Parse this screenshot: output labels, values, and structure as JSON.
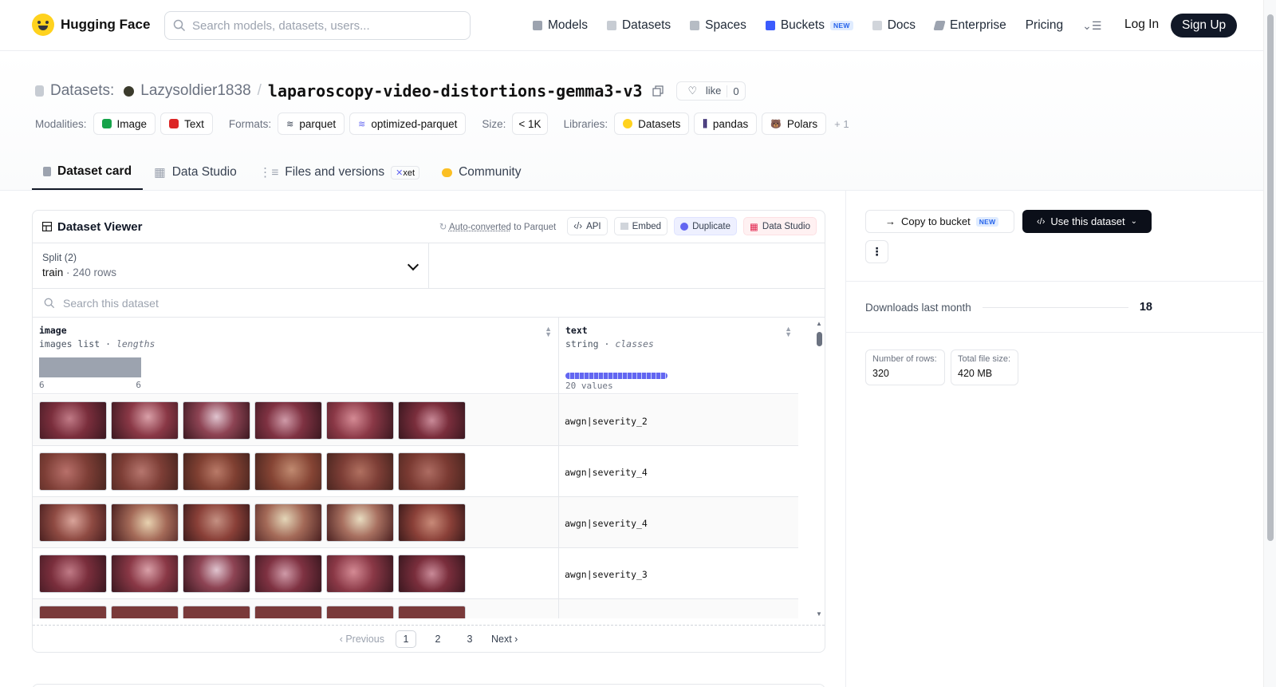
{
  "brand": {
    "name": "Hugging Face"
  },
  "search": {
    "placeholder": "Search models, datasets, users..."
  },
  "nav": {
    "items": [
      {
        "label": "Models",
        "icon": "models-icon"
      },
      {
        "label": "Datasets",
        "icon": "datasets-icon"
      },
      {
        "label": "Spaces",
        "icon": "spaces-icon"
      },
      {
        "label": "Buckets",
        "icon": "buckets-icon",
        "badge": "NEW"
      },
      {
        "label": "Docs",
        "icon": "docs-icon"
      },
      {
        "label": "Enterprise",
        "icon": "enterprise-icon"
      },
      {
        "label": "Pricing"
      }
    ],
    "login": "Log In",
    "signup": "Sign Up"
  },
  "repo": {
    "section": "Datasets:",
    "owner": "Lazysoldier1838",
    "separator": "/",
    "name": "laparoscopy-video-distortions-gemma3-v3",
    "like_label": "like",
    "like_count": "0"
  },
  "meta": {
    "modalities_label": "Modalities:",
    "modalities": [
      "Image",
      "Text"
    ],
    "formats_label": "Formats:",
    "formats": [
      "parquet",
      "optimized-parquet"
    ],
    "size_label": "Size:",
    "size": "< 1K",
    "libraries_label": "Libraries:",
    "libraries": [
      "Datasets",
      "pandas",
      "Polars"
    ],
    "more_libraries": "+ 1"
  },
  "tabs": [
    {
      "label": "Dataset card",
      "active": true
    },
    {
      "label": "Data Studio"
    },
    {
      "label": "Files and versions",
      "badge": "xet"
    },
    {
      "label": "Community"
    }
  ],
  "viewer": {
    "title": "Dataset Viewer",
    "auto_converted": "Auto-converted",
    "auto_converted_suffix": "to Parquet",
    "actions": [
      "API",
      "Embed",
      "Duplicate",
      "Data Studio"
    ],
    "split_label": "Split (2)",
    "split_value": "train",
    "split_rows": "240 rows",
    "search_placeholder": "Search this dataset",
    "columns": [
      {
        "name": "image",
        "type": "images list",
        "stat": "lengths",
        "min": "6",
        "max": "6"
      },
      {
        "name": "text",
        "type": "string",
        "stat": "classes",
        "summary": "20 values"
      }
    ],
    "rows": [
      {
        "text": "awgn|severity_2"
      },
      {
        "text": "awgn|severity_4"
      },
      {
        "text": "awgn|severity_4"
      },
      {
        "text": "awgn|severity_3"
      },
      {
        "text": ""
      }
    ],
    "pager": {
      "prev": "Previous",
      "pages": [
        "1",
        "2",
        "3"
      ],
      "current": "1",
      "next": "Next"
    }
  },
  "sidebar": {
    "copy_to_bucket": "Copy to bucket",
    "copy_badge": "NEW",
    "use_dataset": "Use this dataset",
    "more": "⋮",
    "downloads_label": "Downloads last month",
    "downloads_value": "18",
    "stats": [
      {
        "label": "Number of rows:",
        "value": "320"
      },
      {
        "label": "Total file size:",
        "value": "420 MB"
      }
    ]
  }
}
